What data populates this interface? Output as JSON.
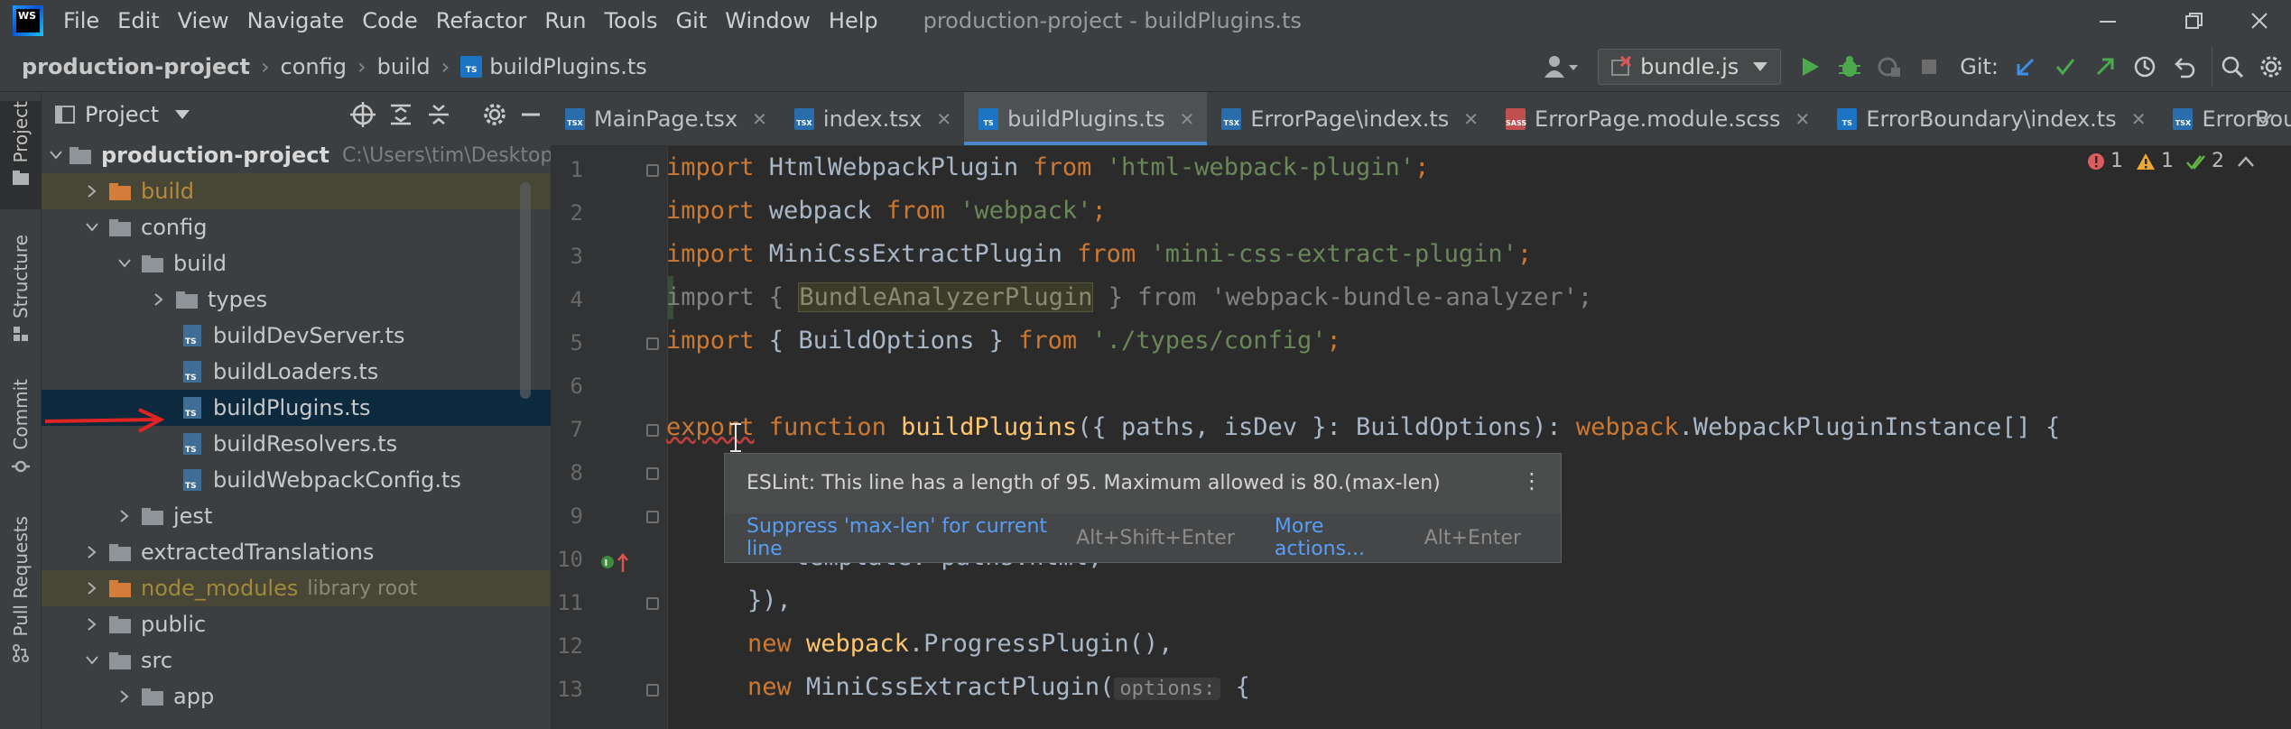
{
  "app": {
    "logo_text": "WS",
    "window_title": "production-project - buildPlugins.ts",
    "menu": [
      "File",
      "Edit",
      "View",
      "Navigate",
      "Code",
      "Refactor",
      "Run",
      "Tools",
      "Git",
      "Window",
      "Help"
    ]
  },
  "navbar": {
    "breadcrumbs": [
      "production-project",
      "config",
      "build",
      "buildPlugins.ts"
    ],
    "run_config": "bundle.js",
    "git_label": "Git:"
  },
  "toolstrip": {
    "tabs": [
      "Project",
      "Structure",
      "Commit",
      "Pull Requests"
    ]
  },
  "project_panel": {
    "title": "Project",
    "tree": [
      {
        "label": "production-project",
        "hint": "C:\\Users\\tim\\Desktop\\",
        "type": "folder"
      },
      {
        "label": "build",
        "type": "folder-excluded"
      },
      {
        "label": "config",
        "type": "folder"
      },
      {
        "label": "build",
        "type": "folder"
      },
      {
        "label": "types",
        "type": "folder"
      },
      {
        "label": "buildDevServer.ts",
        "type": "ts"
      },
      {
        "label": "buildLoaders.ts",
        "type": "ts"
      },
      {
        "label": "buildPlugins.ts",
        "type": "ts"
      },
      {
        "label": "buildResolvers.ts",
        "type": "ts"
      },
      {
        "label": "buildWebpackConfig.ts",
        "type": "ts"
      },
      {
        "label": "jest",
        "type": "folder"
      },
      {
        "label": "extractedTranslations",
        "type": "folder"
      },
      {
        "label": "node_modules",
        "hint": "library root",
        "type": "folder-library"
      },
      {
        "label": "public",
        "type": "folder"
      },
      {
        "label": "src",
        "type": "folder"
      },
      {
        "label": "app",
        "type": "folder"
      }
    ]
  },
  "editor": {
    "tabs": [
      {
        "label": "MainPage.tsx",
        "kind": "tsx"
      },
      {
        "label": "index.tsx",
        "kind": "tsx"
      },
      {
        "label": "buildPlugins.ts",
        "kind": "ts",
        "active": true
      },
      {
        "label": "ErrorPage\\index.ts",
        "kind": "ts"
      },
      {
        "label": "ErrorPage.module.scss",
        "kind": "scss"
      },
      {
        "label": "ErrorBoundary\\index.ts",
        "kind": "ts"
      },
      {
        "label": "ErrorBoundary.",
        "kind": "tsx"
      }
    ],
    "inspections": {
      "errors": "1",
      "warnings": "1",
      "weak": "2"
    },
    "line_numbers": [
      "1",
      "2",
      "3",
      "4",
      "5",
      "6",
      "7",
      "8",
      "9",
      "10",
      "11",
      "12",
      "13"
    ],
    "code": {
      "l1": {
        "kw": "import",
        "name": " HtmlWebpackPlugin ",
        "from": "from",
        "str": " 'html-webpack-plugin'",
        "end": ";"
      },
      "l2": {
        "kw": "import",
        "name": " webpack ",
        "from": "from",
        "str": " 'webpack'",
        "end": ";"
      },
      "l3": {
        "kw": "import",
        "name": " MiniCssExtractPlugin ",
        "from": "from",
        "str": " 'mini-css-extract-plugin'",
        "end": ";"
      },
      "l4": {
        "text_a": "import { ",
        "hl": "BundleAnalyzerPlugin",
        "text_b": " } from 'webpack-bundle-analyzer';"
      },
      "l5": {
        "kw": "import",
        "name": " { BuildOptions } ",
        "from": "from",
        "str": " './types/config'",
        "end": ";"
      },
      "l7": {
        "kw1": "export",
        "kw2": " function ",
        "fn": "buildPlugins",
        "rest1": "({ paths, isDev }: BuildOptions): ",
        "wp": "webpack",
        "rest2": ".WebpackPluginInstance[] {"
      },
      "l10": {
        "text": "template: paths.html,"
      },
      "l11": {
        "text": "}),"
      },
      "l12": {
        "kw": "new",
        "fn": " webpack",
        "rest": ".ProgressPlugin(),"
      },
      "l13": {
        "kw": "new",
        "cls": " MiniCssExtractPlugin",
        "paren": "(",
        "hint": "options:",
        "brace": " {"
      }
    }
  },
  "tooltip": {
    "message": "ESLint: This line has a length of 95. Maximum allowed is 80.(max-len)",
    "action1": "Suppress 'max-len' for current line",
    "action1_key": "Alt+Shift+Enter",
    "action2": "More actions...",
    "action2_key": "Alt+Enter"
  }
}
